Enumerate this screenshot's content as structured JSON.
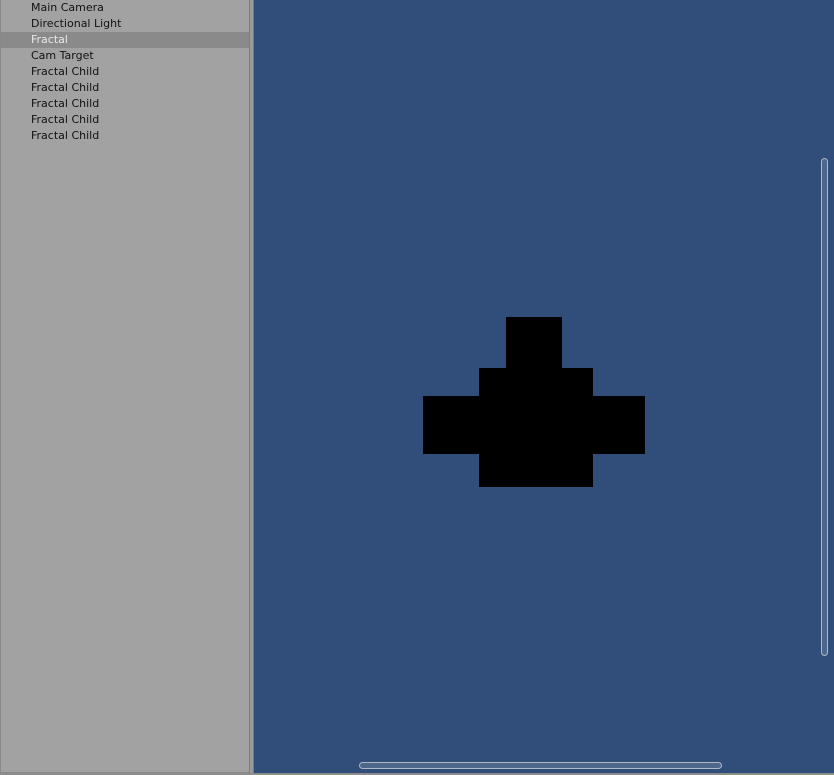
{
  "hierarchy": {
    "items": [
      {
        "label": "Main Camera",
        "selected": false
      },
      {
        "label": "Directional Light",
        "selected": false
      },
      {
        "label": "Fractal",
        "selected": true
      },
      {
        "label": "Cam Target",
        "selected": false
      },
      {
        "label": "Fractal Child",
        "selected": false
      },
      {
        "label": "Fractal Child",
        "selected": false
      },
      {
        "label": "Fractal Child",
        "selected": false
      },
      {
        "label": "Fractal Child",
        "selected": false
      },
      {
        "label": "Fractal Child",
        "selected": false
      }
    ]
  },
  "scene": {
    "background_color": "#314d79",
    "object_color": "#000000"
  }
}
